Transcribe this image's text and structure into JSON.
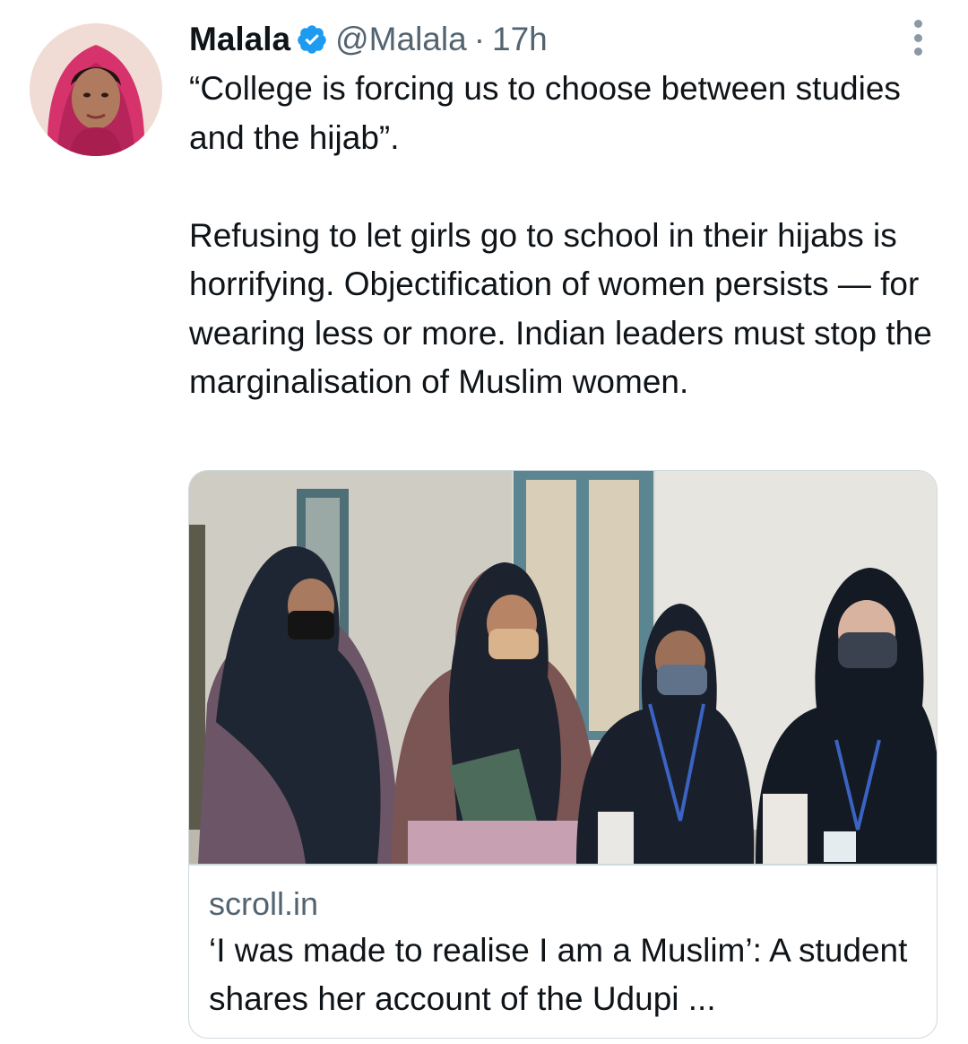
{
  "tweet": {
    "author_name": "Malala",
    "handle": "@Malala",
    "separator": "·",
    "time": "17h",
    "text_paragraph_1": "“College is forcing us to choose between studies and the hijab”.",
    "text_paragraph_2": "Refusing to let girls go to school in their hijabs is horrifying. Objectification of women persists — for wearing less or more. Indian leaders must stop the marginalisation of Muslim women."
  },
  "card": {
    "domain": "scroll.in",
    "title": "‘I was made to realise I am a Muslim’: A student shares her account of the Udupi ..."
  },
  "icons": {
    "verified": "verified-badge-icon",
    "more": "more-vertical-icon"
  },
  "colors": {
    "verified_blue": "#1d9bf0",
    "secondary_text": "#536471",
    "primary_text": "#0f1419",
    "border": "#cfd9de"
  }
}
